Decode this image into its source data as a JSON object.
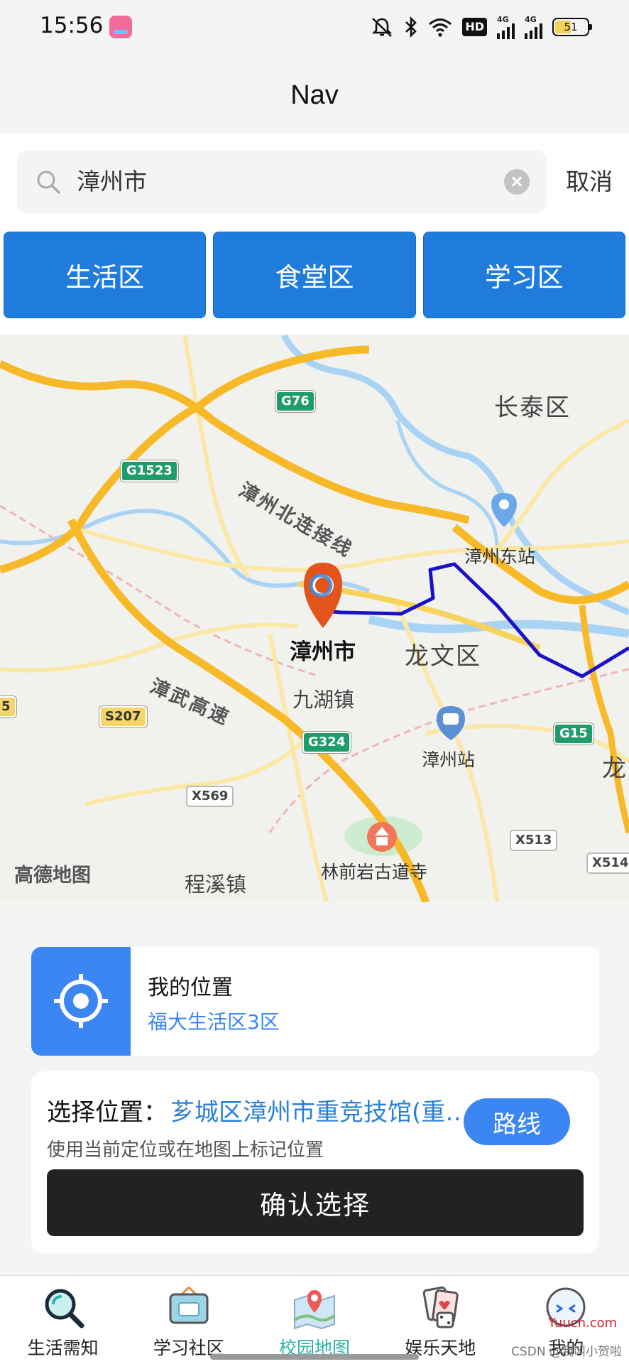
{
  "status_bar": {
    "time": "15:56",
    "network_hd": "HD",
    "sim1_type": "4G",
    "sim2_type": "4G",
    "battery_level": "51",
    "icons": [
      "silent-mode-icon",
      "bluetooth-icon",
      "wifi-icon",
      "hd-voice-icon",
      "signal-icon",
      "battery-icon"
    ]
  },
  "header": {
    "title": "Nav"
  },
  "search": {
    "value": "漳州市",
    "cancel_label": "取消"
  },
  "zones": [
    {
      "label": "生活区"
    },
    {
      "label": "食堂区"
    },
    {
      "label": "学习区"
    }
  ],
  "map": {
    "logo": "高德地图",
    "city_label": "漳州市",
    "districts": [
      "长泰区",
      "龙文区",
      "龙"
    ],
    "towns": [
      "九湖镇",
      "程溪镇"
    ],
    "pois": [
      "漳州东站",
      "漳州站",
      "林前岩古道寺"
    ],
    "roads": [
      "漳州北连接线",
      "漳武高速"
    ],
    "shields": [
      "G76",
      "G1523",
      "S207",
      "G324",
      "X569",
      "G15",
      "X513",
      "X514",
      "5"
    ],
    "route_color": "#1a10c8",
    "marker_color": "#e2541b"
  },
  "location_card": {
    "title": "我的位置",
    "subtitle": "福大生活区3区"
  },
  "choose_card": {
    "label": "选择位置：",
    "value": "芗城区漳州市重竞技馆(重竞技馆)",
    "route_label": "路线",
    "hint": "使用当前定位或在地图上标记位置",
    "confirm_label": "确认选择"
  },
  "tabs": [
    {
      "label": "生活需知",
      "icon": "magnifier-icon"
    },
    {
      "label": "学习社区",
      "icon": "board-icon"
    },
    {
      "label": "校园地图",
      "icon": "map-icon",
      "active": true
    },
    {
      "label": "娱乐天地",
      "icon": "cards-icon"
    },
    {
      "label": "我的",
      "icon": "profile-icon"
    }
  ],
  "watermark": {
    "site": "Yuucn.com",
    "text": "CSDN @我叫小贺啦"
  },
  "colors": {
    "primary_blue": "#1f7cdd",
    "accent_blue": "#3b86f3",
    "active_tab": "#2bb2a8",
    "confirm_bg": "#222222"
  }
}
